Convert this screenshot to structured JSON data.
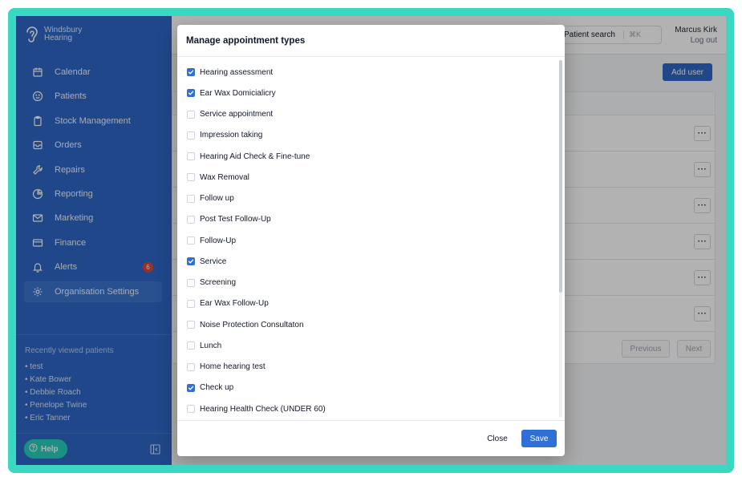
{
  "brand": {
    "line1": "Windsbury",
    "line2": "Hearing"
  },
  "colors": {
    "brand_blue": "#2e66c4",
    "teal": "#27cdb9",
    "badge_red": "#d9473e",
    "checkbox_blue": "#2f6fd6"
  },
  "sidebar": {
    "items": [
      {
        "label": "Calendar",
        "icon": "calendar-icon"
      },
      {
        "label": "Patients",
        "icon": "smiley-icon"
      },
      {
        "label": "Stock Management",
        "icon": "clipboard-icon"
      },
      {
        "label": "Orders",
        "icon": "inbox-icon"
      },
      {
        "label": "Repairs",
        "icon": "wrench-icon"
      },
      {
        "label": "Reporting",
        "icon": "pie-chart-icon"
      },
      {
        "label": "Marketing",
        "icon": "envelope-icon"
      },
      {
        "label": "Finance",
        "icon": "credit-card-icon"
      },
      {
        "label": "Alerts",
        "icon": "bell-icon",
        "badge": "6"
      },
      {
        "label": "Organisation Settings",
        "icon": "gear-icon",
        "active": true
      }
    ],
    "recent_title": "Recently viewed patients",
    "recent": [
      "• test",
      "• Kate Bower",
      "• Debbie Roach",
      "• Penelope Twine",
      "• Eric Tanner"
    ],
    "help_label": "Help"
  },
  "header": {
    "search_label": "Patient search",
    "search_shortcut": "⌘K",
    "user_name": "Marcus Kirk",
    "logout_label": "Log out"
  },
  "main": {
    "add_user_label": "Add user",
    "more_label": "···",
    "previous_label": "Previous",
    "next_label": "Next"
  },
  "modal": {
    "title": "Manage appointment types",
    "options": [
      {
        "label": "Hearing assessment",
        "checked": true
      },
      {
        "label": "Ear Wax Domicialicry",
        "checked": true
      },
      {
        "label": "Service appointment",
        "checked": false
      },
      {
        "label": "Impression taking",
        "checked": false
      },
      {
        "label": "Hearing Aid Check & Fine-tune",
        "checked": false
      },
      {
        "label": "Wax Removal",
        "checked": false
      },
      {
        "label": "Follow up",
        "checked": false
      },
      {
        "label": "Post Test Follow-Up",
        "checked": false
      },
      {
        "label": "Follow-Up",
        "checked": false
      },
      {
        "label": "Service",
        "checked": true
      },
      {
        "label": "Screening",
        "checked": false
      },
      {
        "label": "Ear Wax Follow-Up",
        "checked": false
      },
      {
        "label": "Noise Protection Consultaton",
        "checked": false
      },
      {
        "label": "Lunch",
        "checked": false
      },
      {
        "label": "Home hearing test",
        "checked": false
      },
      {
        "label": "Check up",
        "checked": true
      },
      {
        "label": "Hearing Health Check (UNDER 60)",
        "checked": false
      }
    ],
    "close_label": "Close",
    "save_label": "Save"
  }
}
